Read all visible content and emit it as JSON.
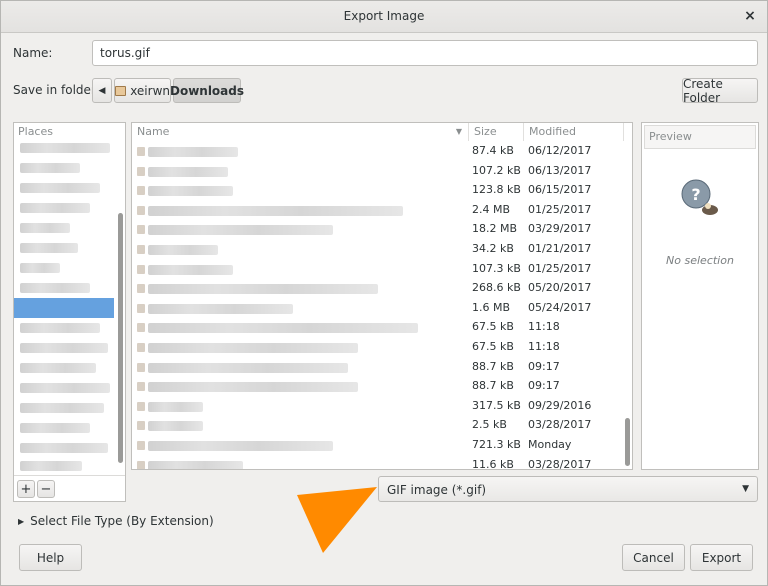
{
  "dialog": {
    "title": "Export Image",
    "close_icon": "×"
  },
  "name_row": {
    "label": "Name:",
    "value": "torus.gif"
  },
  "folder_row": {
    "label": "Save in folder:",
    "back_icon": "◀",
    "path": [
      "xeirwn",
      "Downloads"
    ],
    "create_folder": "Create Folder"
  },
  "places": {
    "header": "Places",
    "add": "+",
    "remove": "−"
  },
  "files": {
    "columns": {
      "name": "Name",
      "size": "Size",
      "modified": "Modified"
    },
    "rows": [
      {
        "size": "87.4 kB",
        "modified": "06/12/2017"
      },
      {
        "size": "107.2 kB",
        "modified": "06/13/2017"
      },
      {
        "size": "123.8 kB",
        "modified": "06/15/2017"
      },
      {
        "size": "2.4 MB",
        "modified": "01/25/2017"
      },
      {
        "size": "18.2 MB",
        "modified": "03/29/2017"
      },
      {
        "size": "34.2 kB",
        "modified": "01/21/2017"
      },
      {
        "size": "107.3 kB",
        "modified": "01/25/2017"
      },
      {
        "size": "268.6 kB",
        "modified": "05/20/2017"
      },
      {
        "size": "1.6 MB",
        "modified": "05/24/2017"
      },
      {
        "size": "67.5 kB",
        "modified": "11:18"
      },
      {
        "size": "67.5 kB",
        "modified": "11:18"
      },
      {
        "size": "88.7 kB",
        "modified": "09:17"
      },
      {
        "size": "88.7 kB",
        "modified": "09:17"
      },
      {
        "size": "317.5 kB",
        "modified": "09/29/2016"
      },
      {
        "size": "2.5 kB",
        "modified": "03/28/2017"
      },
      {
        "size": "721.3 kB",
        "modified": "Monday"
      },
      {
        "size": "11.6 kB",
        "modified": "03/28/2017"
      }
    ]
  },
  "preview": {
    "header": "Preview",
    "empty": "No selection"
  },
  "filter": {
    "selected": "GIF image (*.gif)"
  },
  "file_type": {
    "label": "Select File Type (By Extension)"
  },
  "buttons": {
    "help": "Help",
    "cancel": "Cancel",
    "export": "Export"
  },
  "colors": {
    "accent_arrow": "#ff8a00",
    "selection": "#4a90d9"
  }
}
